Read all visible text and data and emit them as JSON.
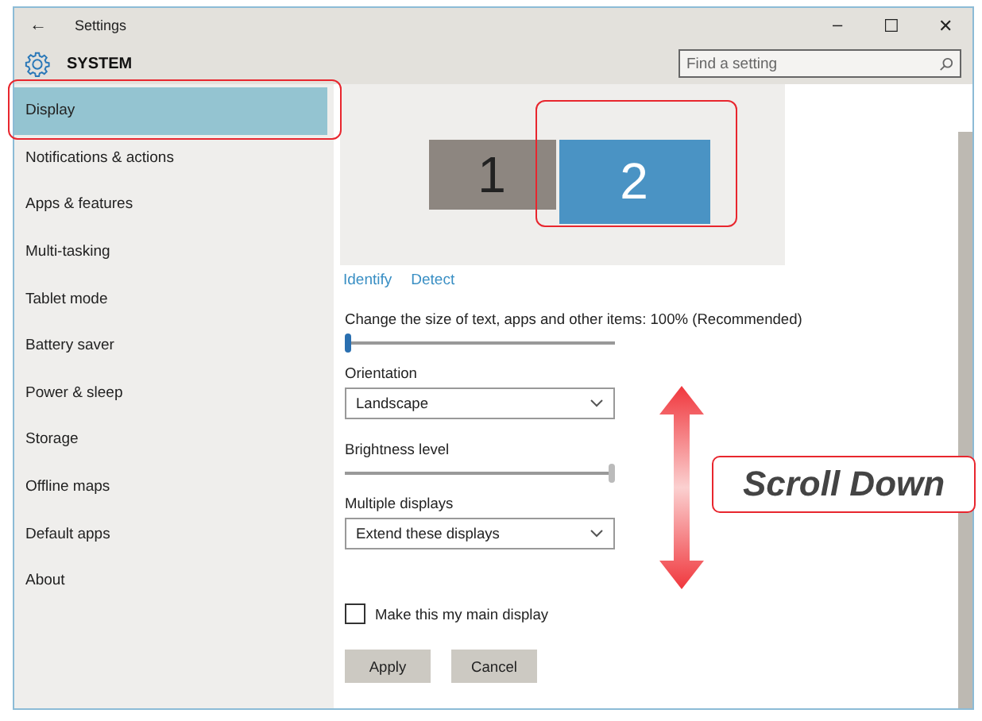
{
  "window": {
    "title": "Settings",
    "back": "←",
    "controls": [
      "–",
      "☐",
      "✕"
    ]
  },
  "header": {
    "title": "SYSTEM",
    "search": {
      "placeholder": "Find a setting"
    }
  },
  "sidebar": {
    "items": [
      {
        "label": "Display",
        "selected": true
      },
      {
        "label": "Notifications & actions",
        "selected": false
      },
      {
        "label": "Apps & features",
        "selected": false
      },
      {
        "label": "Multi-tasking",
        "selected": false
      },
      {
        "label": "Tablet mode",
        "selected": false
      },
      {
        "label": "Battery saver",
        "selected": false
      },
      {
        "label": "Power & sleep",
        "selected": false
      },
      {
        "label": "Storage",
        "selected": false
      },
      {
        "label": "Offline maps",
        "selected": false
      },
      {
        "label": "Default apps",
        "selected": false
      },
      {
        "label": "About",
        "selected": false
      }
    ]
  },
  "display": {
    "monitors": [
      {
        "label": "1",
        "selected": false
      },
      {
        "label": "2",
        "selected": true
      }
    ],
    "links": [
      "Identify",
      "Detect"
    ],
    "settings": [
      {
        "kind": "slider",
        "label": "Change the size of text, apps and other items: 100% (Recommended)",
        "level": 0
      },
      {
        "kind": "dropdown",
        "label": "Orientation",
        "value": "Landscape"
      },
      {
        "kind": "slider",
        "label": "Brightness level",
        "level": 1
      },
      {
        "kind": "dropdown",
        "label": "Multiple displays",
        "value": "Extend these displays"
      },
      {
        "kind": "checkbox",
        "label": "Make this my main display",
        "checked": false
      }
    ],
    "buttons": [
      "Apply",
      "Cancel"
    ]
  },
  "annotation": {
    "callout": "Scroll Down"
  }
}
